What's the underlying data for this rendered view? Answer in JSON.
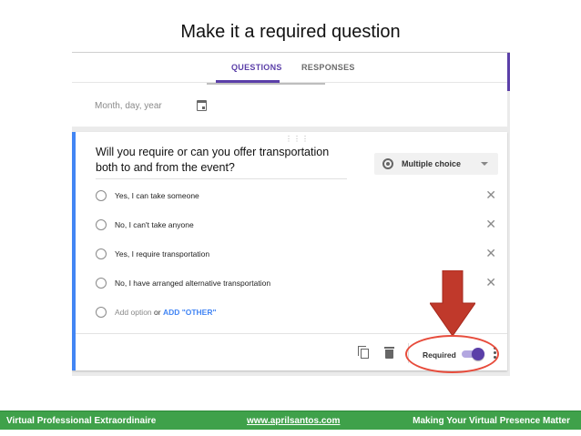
{
  "slide": {
    "title": "Make it a required question"
  },
  "tabs": {
    "questions": "QUESTIONS",
    "responses": "RESPONSES"
  },
  "previous_question": {
    "date_placeholder": "Month, day, year"
  },
  "question": {
    "title": "Will you require or can you offer transportation both to and from the event?",
    "type": "Multiple choice",
    "options": [
      "Yes, I can take someone",
      "No, I can't take anyone",
      "Yes, I require transportation",
      "No, I have arranged alternative transportation"
    ],
    "add_option": "Add option",
    "or_text": " or ",
    "add_other": "ADD \"OTHER\"",
    "required_label": "Required",
    "required_on": true
  },
  "annotation": {
    "color": "#e74c3c"
  },
  "footer": {
    "left": "Virtual Professional Extraordinaire",
    "center": "www.aprilsantos.com",
    "right": "Making Your Virtual Presence Matter",
    "bar_color": "#3fa14a"
  },
  "colors": {
    "accent": "#5b3fa8",
    "active_card_border": "#4285f4"
  }
}
